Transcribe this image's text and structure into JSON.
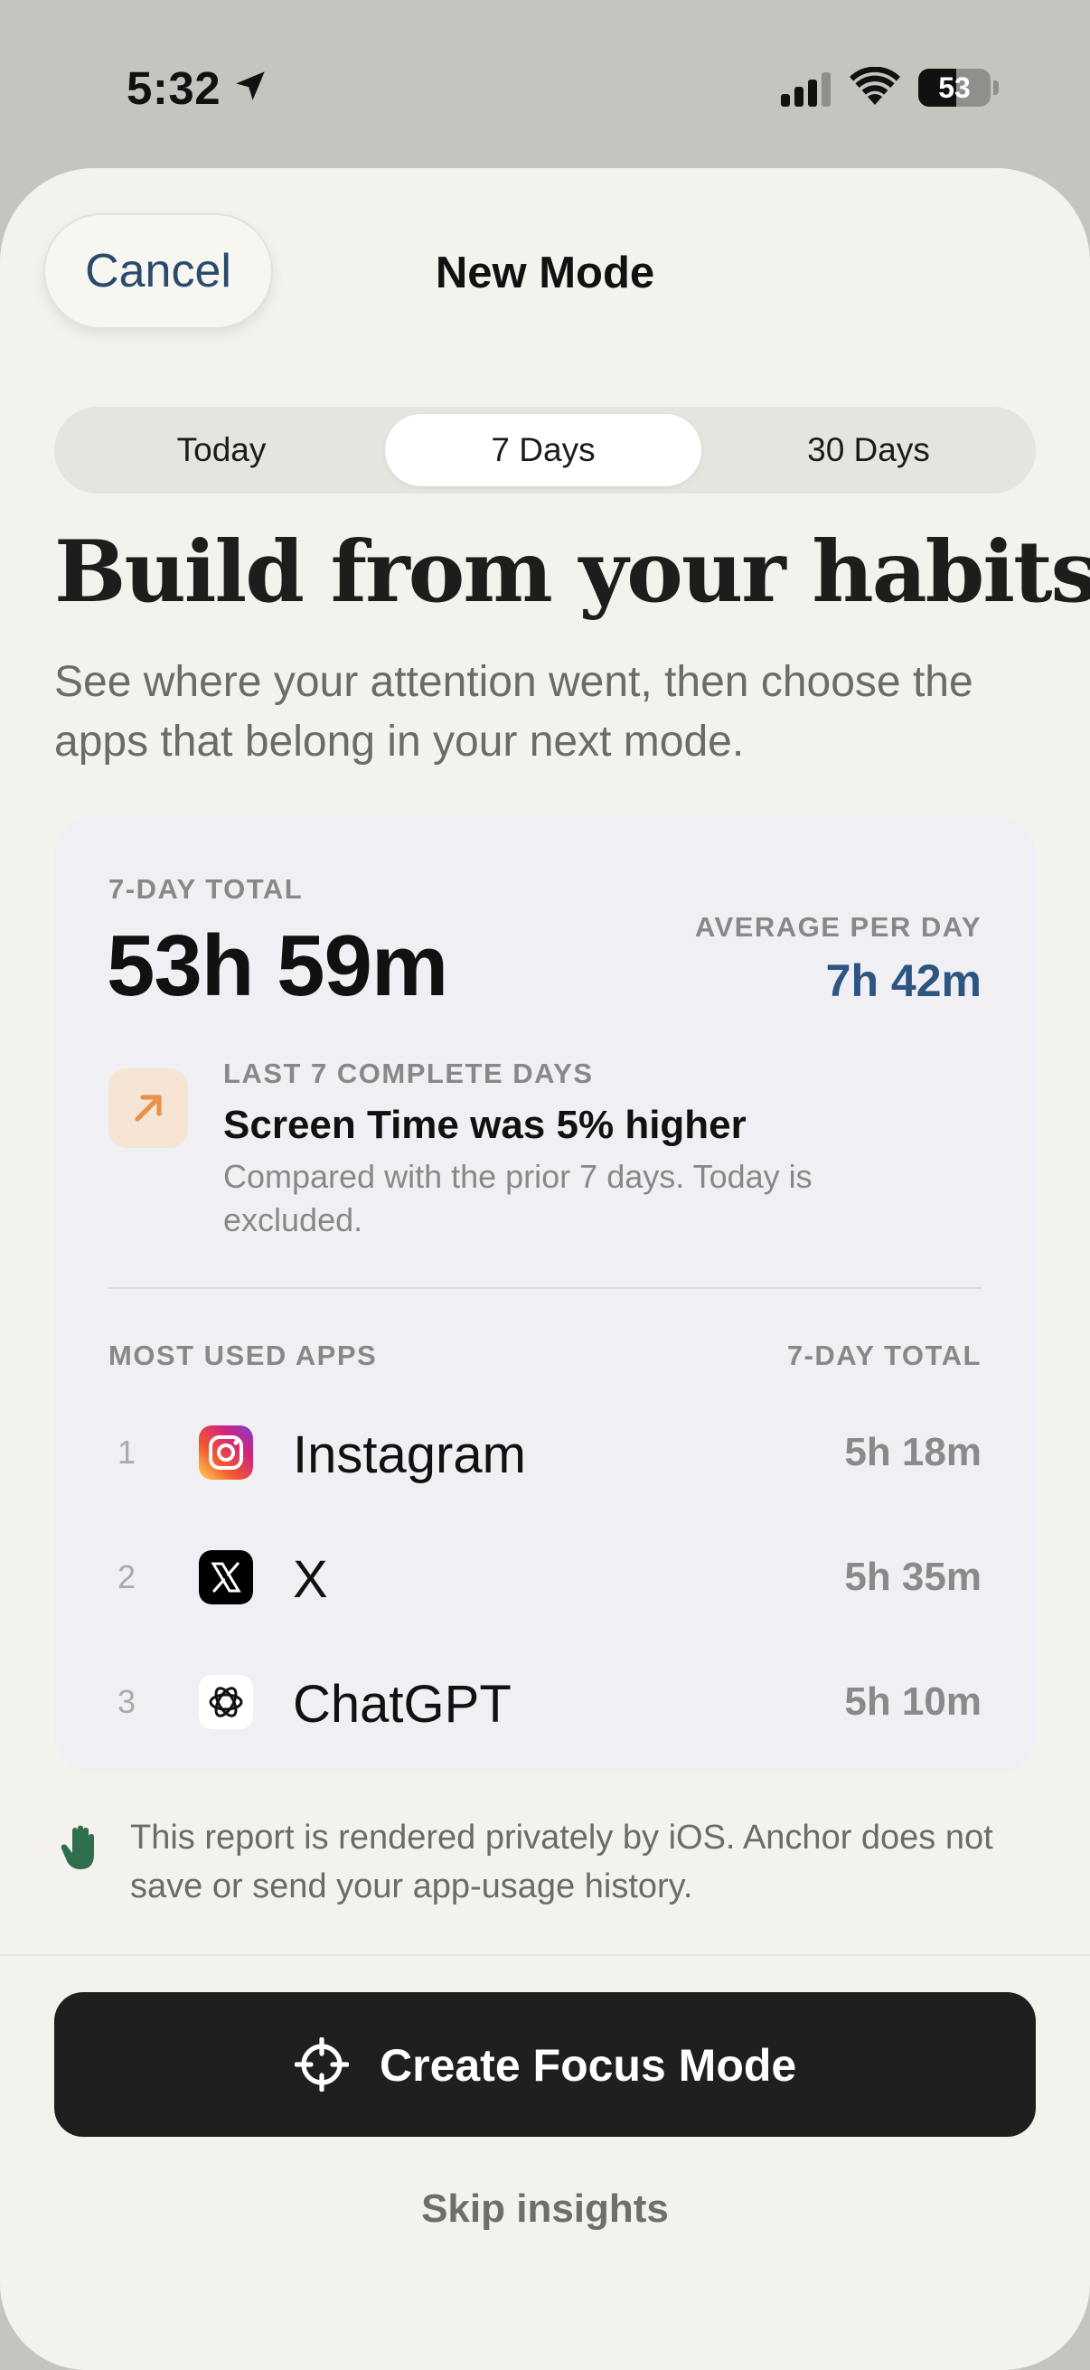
{
  "status_bar": {
    "time": "5:32",
    "battery_level": "53",
    "battery_fraction": 0.53
  },
  "header": {
    "cancel_label": "Cancel",
    "title": "New Mode"
  },
  "segments": [
    {
      "label": "Today",
      "selected": false
    },
    {
      "label": "7 Days",
      "selected": true
    },
    {
      "label": "30 Days",
      "selected": false
    }
  ],
  "intro": {
    "headline": "Build from your habits",
    "subtext": "See where your attention went, then choose the apps that belong in your next mode."
  },
  "summary": {
    "total_label": "7-DAY TOTAL",
    "total_value": "53h 59m",
    "average_label": "AVERAGE PER DAY",
    "average_value": "7h 42m"
  },
  "trend": {
    "icon": "arrow-up-right-icon",
    "label": "LAST 7 COMPLETE DAYS",
    "title": "Screen Time was 5% higher",
    "description": "Compared with the prior 7 days. Today is excluded."
  },
  "apps": {
    "header_label": "MOST USED APPS",
    "total_label": "7-DAY TOTAL",
    "items": [
      {
        "rank": "1",
        "name": "Instagram",
        "time": "5h 18m",
        "icon": "instagram-icon"
      },
      {
        "rank": "2",
        "name": "X",
        "time": "5h 35m",
        "icon": "x-icon"
      },
      {
        "rank": "3",
        "name": "ChatGPT",
        "time": "5h 10m",
        "icon": "chatgpt-icon"
      }
    ]
  },
  "privacy": {
    "icon": "hand-icon",
    "text": "This report is rendered privately by iOS. Anchor does not save or send your app-usage history."
  },
  "actions": {
    "create_label": "Create Focus Mode",
    "create_icon": "crosshair-icon",
    "skip_label": "Skip insights"
  },
  "colors": {
    "accent_blue": "#2c5582",
    "sheet_bg": "#f3f2ec",
    "card_bg": "#f0eff4",
    "primary_button": "#1f1f1e",
    "trend_orange": "#e8914a",
    "privacy_green": "#2f6e4d"
  }
}
